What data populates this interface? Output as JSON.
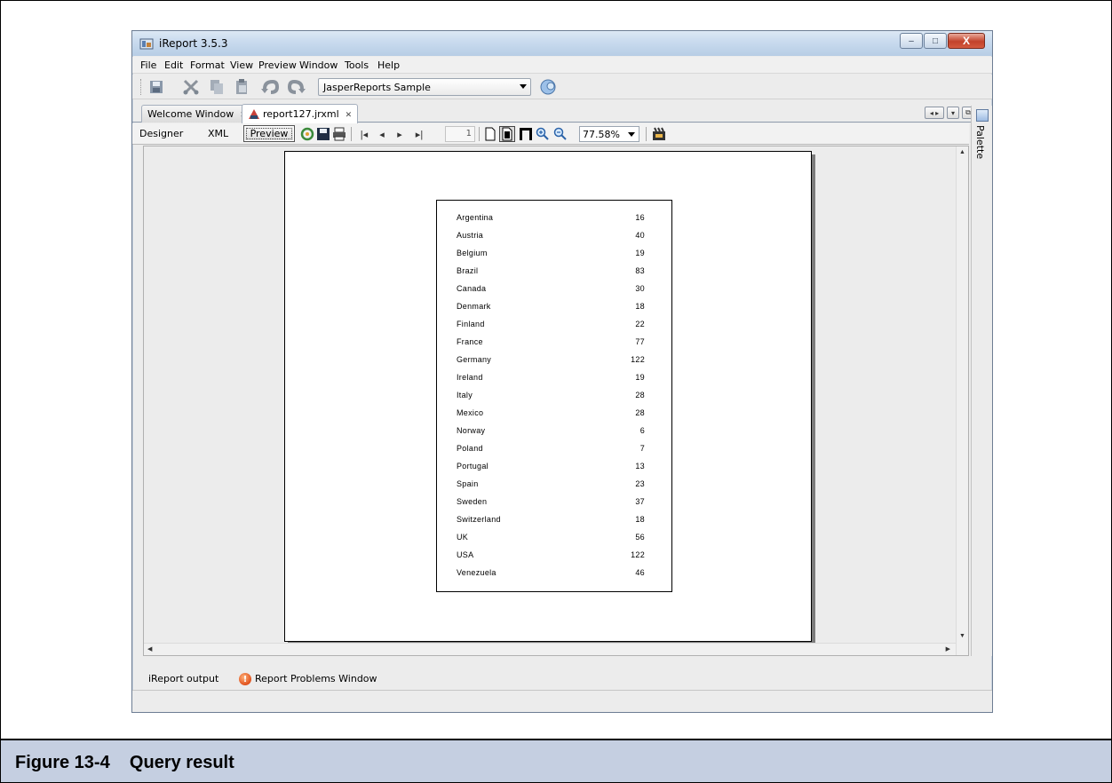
{
  "window": {
    "title": "iReport 3.5.3",
    "controls": {
      "minimize": "–",
      "maximize": "□",
      "close": "X"
    }
  },
  "menu": [
    {
      "label": "File",
      "mnemonic": "F"
    },
    {
      "label": "Edit",
      "mnemonic": "E"
    },
    {
      "label": "Format",
      "mnemonic": ""
    },
    {
      "label": "View",
      "mnemonic": "V"
    },
    {
      "label": "Preview",
      "mnemonic": ""
    },
    {
      "label": "Window",
      "mnemonic": "W"
    },
    {
      "label": "Tools",
      "mnemonic": "T"
    },
    {
      "label": "Help",
      "mnemonic": "H"
    }
  ],
  "toolbar": {
    "datasource": "JasperReports Sample",
    "icons": [
      "save-icon",
      "cut-icon",
      "copy-icon",
      "paste-icon",
      "undo-icon",
      "redo-icon",
      "datasource-report-icon"
    ]
  },
  "tabs": [
    {
      "label": "Welcome Window",
      "active": false,
      "close": "✕"
    },
    {
      "label": "report127.jrxml",
      "active": true,
      "close": "✕"
    }
  ],
  "side_panel": {
    "label": "Palette"
  },
  "preview_toolbar": {
    "designer": "Designer",
    "xml": "XML",
    "preview": "Preview",
    "page_number": "1",
    "zoom": "77.58%",
    "nav": {
      "first": "|◂",
      "prev": "◂",
      "next": "▸",
      "last": "▸|"
    }
  },
  "report": {
    "rows": [
      {
        "country": "Argentina",
        "count": "16"
      },
      {
        "country": "Austria",
        "count": "40"
      },
      {
        "country": "Belgium",
        "count": "19"
      },
      {
        "country": "Brazil",
        "count": "83"
      },
      {
        "country": "Canada",
        "count": "30"
      },
      {
        "country": "Denmark",
        "count": "18"
      },
      {
        "country": "Finland",
        "count": "22"
      },
      {
        "country": "France",
        "count": "77"
      },
      {
        "country": "Germany",
        "count": "122"
      },
      {
        "country": "Ireland",
        "count": "19"
      },
      {
        "country": "Italy",
        "count": "28"
      },
      {
        "country": "Mexico",
        "count": "28"
      },
      {
        "country": "Norway",
        "count": "6"
      },
      {
        "country": "Poland",
        "count": "7"
      },
      {
        "country": "Portugal",
        "count": "13"
      },
      {
        "country": "Spain",
        "count": "23"
      },
      {
        "country": "Sweden",
        "count": "37"
      },
      {
        "country": "Switzerland",
        "count": "18"
      },
      {
        "country": "UK",
        "count": "56"
      },
      {
        "country": "USA",
        "count": "122"
      },
      {
        "country": "Venezuela",
        "count": "46"
      }
    ]
  },
  "output_bar": {
    "ireport_output": "iReport output",
    "problems": "Report Problems Window",
    "problems_icon": "!"
  },
  "caption": "Figure 13-4    Query result"
}
